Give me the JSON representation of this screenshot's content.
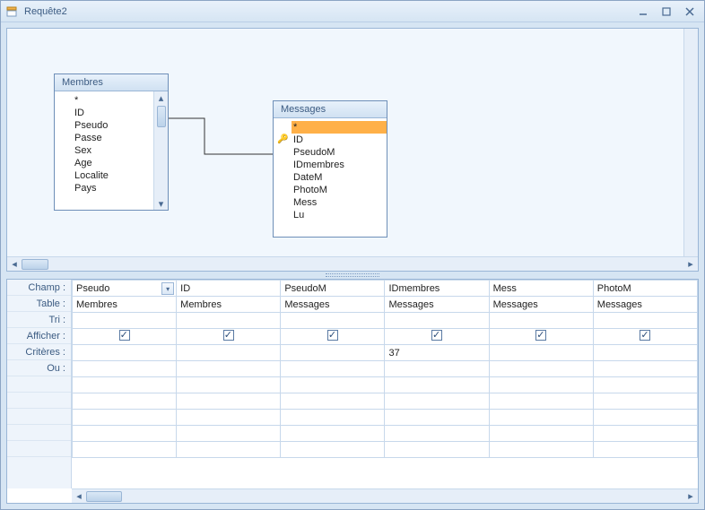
{
  "window": {
    "title": "Requête2"
  },
  "tables": {
    "membres": {
      "name": "Membres",
      "fields": [
        "*",
        "ID",
        "Pseudo",
        "Passe",
        "Sex",
        "Age",
        "Localite",
        "Pays"
      ]
    },
    "messages": {
      "name": "Messages",
      "fields": [
        "*",
        "ID",
        "PseudoM",
        "IDmembres",
        "DateM",
        "PhotoM",
        "Mess",
        "Lu"
      ],
      "selected_index": 0,
      "pk_index": 1
    }
  },
  "grid": {
    "row_labels": [
      "Champ :",
      "Table :",
      "Tri :",
      "Afficher :",
      "Critères :",
      "Ou :"
    ],
    "columns": [
      {
        "champ": "Pseudo",
        "table": "Membres",
        "tri": "",
        "afficher": true,
        "criteres": "",
        "ou": "",
        "has_dropdown": true
      },
      {
        "champ": "ID",
        "table": "Membres",
        "tri": "",
        "afficher": true,
        "criteres": "",
        "ou": ""
      },
      {
        "champ": "PseudoM",
        "table": "Messages",
        "tri": "",
        "afficher": true,
        "criteres": "",
        "ou": ""
      },
      {
        "champ": "IDmembres",
        "table": "Messages",
        "tri": "",
        "afficher": true,
        "criteres": "37",
        "ou": ""
      },
      {
        "champ": "Mess",
        "table": "Messages",
        "tri": "",
        "afficher": true,
        "criteres": "",
        "ou": ""
      },
      {
        "champ": "PhotoM",
        "table": "Messages",
        "tri": "",
        "afficher": true,
        "criteres": "",
        "ou": ""
      }
    ]
  }
}
